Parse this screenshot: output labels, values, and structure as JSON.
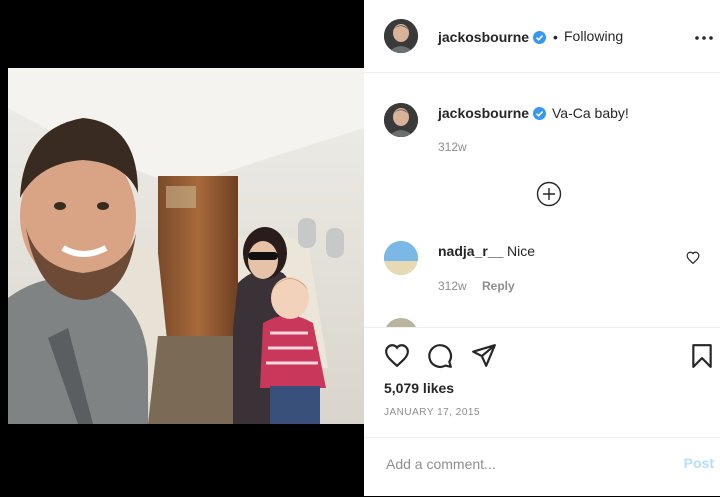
{
  "post": {
    "author": "jackosbourne",
    "follow_status": "Following",
    "separator": "•",
    "caption": "Va-Ca baby!",
    "caption_age": "312w",
    "likes": "5,079 likes",
    "date": "JANUARY 17, 2015"
  },
  "comments": [
    {
      "user": "nadja_r__",
      "text": "Nice",
      "age": "312w",
      "reply": "Reply"
    }
  ],
  "add_comment": {
    "placeholder": "Add a comment...",
    "post_label": "Post"
  },
  "colors": {
    "verified": "#3897f0",
    "post_disabled": "#b2dffc",
    "muted": "#8e8e8e"
  },
  "icons": [
    "more-options-icon",
    "load-more-comments-icon",
    "heart-icon",
    "comment-icon",
    "share-icon",
    "bookmark-icon",
    "verified-badge-icon"
  ]
}
